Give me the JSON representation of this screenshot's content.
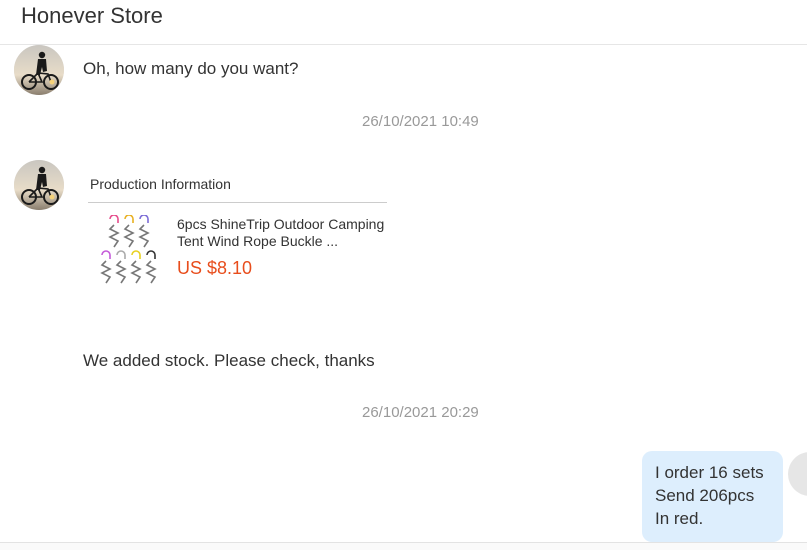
{
  "header": {
    "title": "Honever Store"
  },
  "messages": {
    "m1": {
      "text": "Oh, how many do you want?"
    },
    "ts1": {
      "text": "26/10/2021 10:49"
    },
    "product_card": {
      "heading": "Production Information",
      "name": "6pcs ShineTrip Outdoor Camping Tent Wind Rope Buckle ...",
      "price": "US $8.10"
    },
    "m2": {
      "text": "We added stock. Please check, thanks"
    },
    "ts2": {
      "text": "26/10/2021 20:29"
    },
    "outgoing": {
      "line1": "I order 16 sets",
      "line2": "Send 206pcs",
      "line3": "In red."
    }
  },
  "colors": {
    "price": "#e84d1c",
    "outgoing_bubble": "#ddeefd",
    "timestamp": "#999999"
  },
  "icons": {
    "seller_avatar": "cyclist-silhouette-avatar",
    "user_avatar": "user-avatar"
  }
}
